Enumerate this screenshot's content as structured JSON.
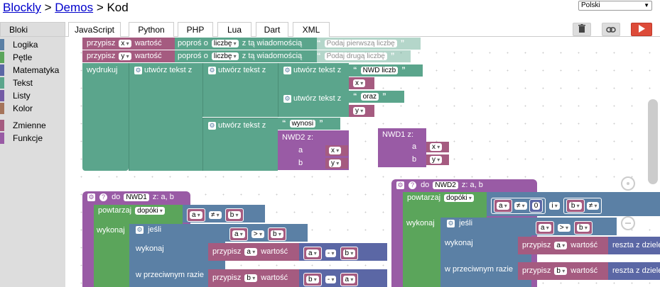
{
  "header": {
    "crumb_blockly": "Blockly",
    "crumb_sep1": " > ",
    "crumb_demos": "Demos",
    "crumb_sep2": " > ",
    "crumb_code": "Kod"
  },
  "language_select": {
    "value": "Polski"
  },
  "tabs": {
    "blocks": "Bloki",
    "javascript": "JavaScript",
    "python": "Python",
    "php": "PHP",
    "lua": "Lua",
    "dart": "Dart",
    "xml": "XML"
  },
  "toolbar_icons": {
    "trash": "trash-icon",
    "link": "link-icon",
    "run": "run-icon"
  },
  "toolbox": [
    {
      "label": "Logika",
      "color": "#5b80a5"
    },
    {
      "label": "Pętle",
      "color": "#5ba55b"
    },
    {
      "label": "Matematyka",
      "color": "#5b67a5"
    },
    {
      "label": "Tekst",
      "color": "#5ba58c"
    },
    {
      "label": "Listy",
      "color": "#745ba5"
    },
    {
      "label": "Kolor",
      "color": "#a5745b"
    },
    {
      "label": "Zmienne",
      "color": "#a55b80"
    },
    {
      "label": "Funkcje",
      "color": "#995ba5"
    }
  ],
  "blocks": {
    "assign": "przypisz",
    "value_word": "wartość",
    "x": "x",
    "y": "y",
    "prompt": "poproś o",
    "number": "liczbę",
    "with_msg": "z tą wiadomością",
    "prompt_msg1": "Podaj pierwszą liczbę",
    "prompt_msg2": "Podaj drugą liczbę",
    "print": "wydrukuj",
    "create_text": "utwórz tekst z",
    "nwd_label": "NWD liczb",
    "and_label": "oraz",
    "is_label": "wynosi",
    "nwd2_call": "NWD2  z:",
    "nwd1_call": "NWD1  z:",
    "a": "a",
    "b": "b",
    "func_to": "do",
    "func1_name": "NWD1",
    "func2_name": "NWD2",
    "params": "z: a, b",
    "repeat": "powtarzaj",
    "while": "dopóki",
    "neq": "≠",
    "gt": ">",
    "minus": "-",
    "zero": "0",
    "do": "wykonaj",
    "if": "jeśli",
    "else": "w przeciwnym razie",
    "remainder": "reszta z dziele",
    "open_quote": "“",
    "close_quote": "”"
  }
}
